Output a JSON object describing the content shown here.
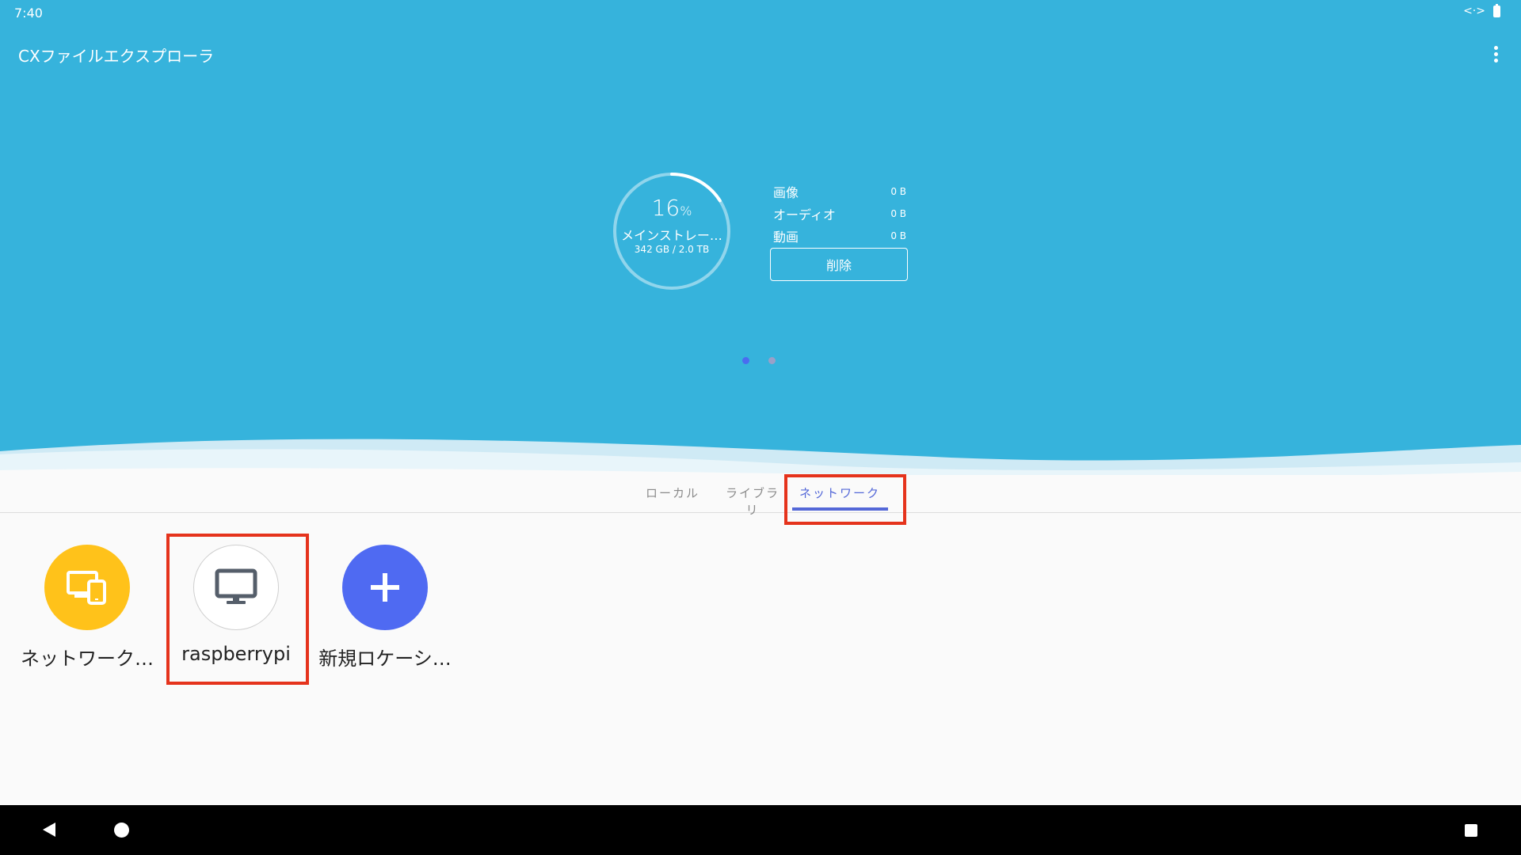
{
  "status_bar": {
    "time": "7:40",
    "icons": [
      "code-arrows-icon",
      "battery-icon"
    ]
  },
  "app_bar": {
    "title": "CXファイルエクスプローラ",
    "menu_icon": "more-vert-icon"
  },
  "storage": {
    "percent": "16",
    "percent_unit": "%",
    "used_fraction": 0.16,
    "label": "メインストレー…",
    "size": "342 GB / 2.0 TB",
    "categories": [
      {
        "name": "画像",
        "value": "0 B"
      },
      {
        "name": "オーディオ",
        "value": "0 B"
      },
      {
        "name": "動画",
        "value": "0 B"
      }
    ],
    "delete_label": "削除"
  },
  "pager": {
    "count": 2,
    "active": 0
  },
  "tabs": [
    {
      "label": "ローカル",
      "active": false
    },
    {
      "label": "ライブラリ",
      "active": false
    },
    {
      "label": "ネットワーク",
      "active": true
    }
  ],
  "network_items": [
    {
      "label": "ネットワーク…",
      "icon": "devices-icon",
      "color": "#ffc21a"
    },
    {
      "label": "raspberrypi",
      "icon": "desktop-monitor-icon",
      "color": "#ffffff"
    },
    {
      "label": "新規ロケーシ…",
      "icon": "plus-icon",
      "color": "#4f6af2"
    }
  ],
  "colors": {
    "header": "#36b3dc",
    "accent": "#5468d8",
    "highlight": "#e5331c"
  },
  "nav_bar": {
    "icons": [
      "back-icon",
      "home-icon",
      "recents-icon"
    ]
  }
}
